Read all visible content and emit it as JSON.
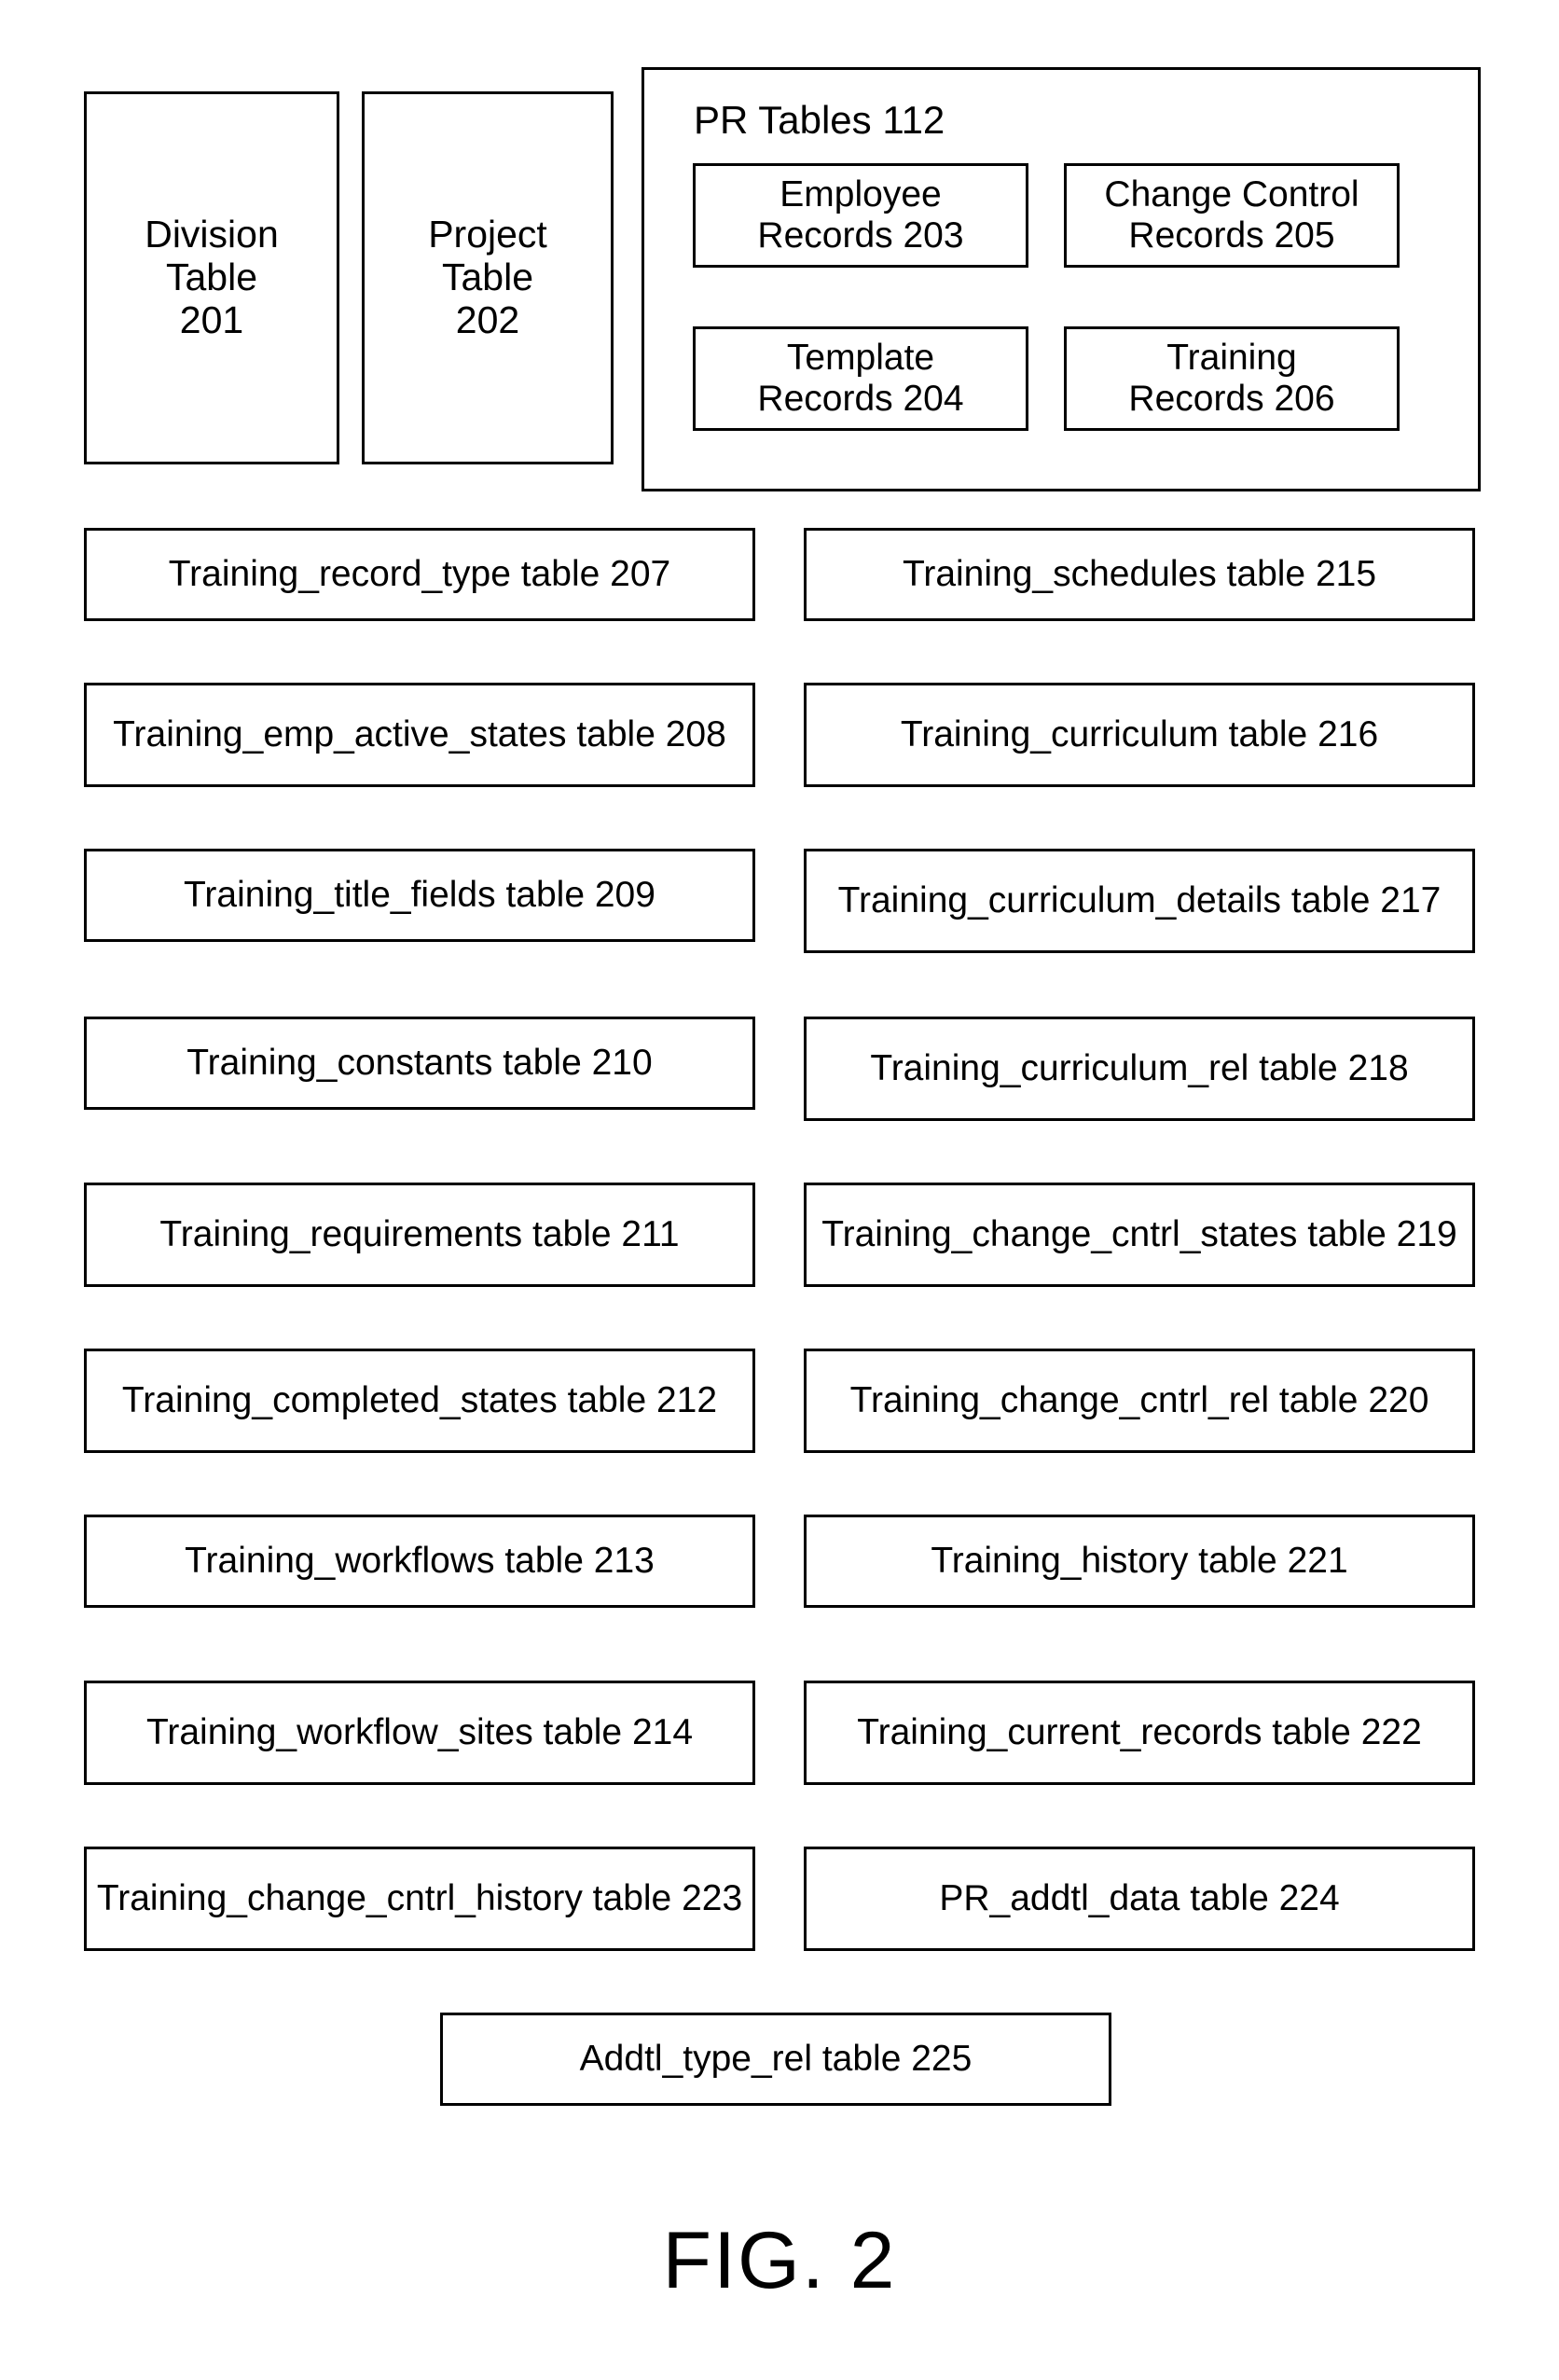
{
  "figure": {
    "caption": "FIG. 2"
  },
  "top_row": {
    "division_table": {
      "line1": "Division",
      "line2": "Table",
      "line3": "201"
    },
    "project_table": {
      "line1": "Project",
      "line2": "Table",
      "line3": "202"
    },
    "pr_tables": {
      "title": "PR Tables 112",
      "records": [
        {
          "line1": "Employee",
          "line2": "Records 203"
        },
        {
          "line1": "Change Control",
          "line2": "Records 205"
        },
        {
          "line1": "Template",
          "line2": "Records 204"
        },
        {
          "line1": "Training",
          "line2": "Records 206"
        }
      ]
    }
  },
  "left_column": [
    {
      "label": "Training_record_type table 207"
    },
    {
      "label": "Training_emp_active_states table 208"
    },
    {
      "label": "Training_title_fields table 209"
    },
    {
      "label": "Training_constants table 210"
    },
    {
      "label": "Training_requirements table 211"
    },
    {
      "label": "Training_completed_states table 212"
    },
    {
      "label": "Training_workflows table 213"
    },
    {
      "label": "Training_workflow_sites table 214"
    },
    {
      "label": "Training_change_cntrl_history table 223"
    }
  ],
  "right_column": [
    {
      "label": "Training_schedules table 215"
    },
    {
      "label": "Training_curriculum table 216"
    },
    {
      "label": "Training_curriculum_details table 217"
    },
    {
      "label": "Training_curriculum_rel table 218"
    },
    {
      "label": "Training_change_cntrl_states table 219"
    },
    {
      "label": "Training_change_cntrl_rel table 220"
    },
    {
      "label": "Training_history table 221"
    },
    {
      "label": "Training_current_records table 222"
    },
    {
      "label": "PR_addtl_data table 224"
    }
  ],
  "bottom_row": [
    {
      "label": "Addtl_type_rel table 225"
    }
  ],
  "colors": {
    "stroke": "#000000",
    "background": "#ffffff"
  }
}
